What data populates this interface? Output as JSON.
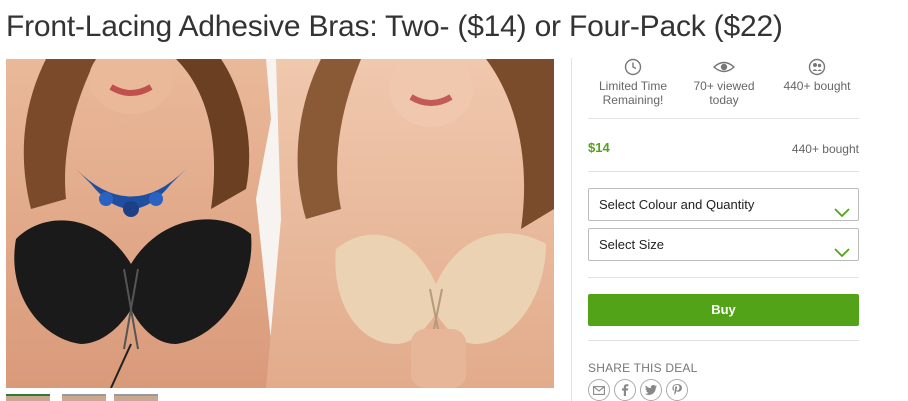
{
  "deal": {
    "title": "Front-Lacing Adhesive Bras: Two- ($14) or Four-Pack ($22)"
  },
  "stats": [
    {
      "icon": "clock-icon",
      "line1": "Limited Time",
      "line2": "Remaining!"
    },
    {
      "icon": "eye-icon",
      "line1": "70+ viewed",
      "line2": "today"
    },
    {
      "icon": "people-icon",
      "line1": "440+ bought",
      "line2": ""
    }
  ],
  "pricing": {
    "price": "$14",
    "bought": "440+ bought"
  },
  "options": {
    "colour_quantity": "Select Colour and Quantity",
    "size": "Select Size"
  },
  "actions": {
    "buy_label": "Buy"
  },
  "share": {
    "label": "SHARE THIS DEAL",
    "icons": [
      "email-icon",
      "facebook-icon",
      "twitter-icon",
      "pinterest-icon"
    ]
  },
  "colors": {
    "accent_green": "#53a318",
    "text": "#333333",
    "muted": "#666666"
  }
}
